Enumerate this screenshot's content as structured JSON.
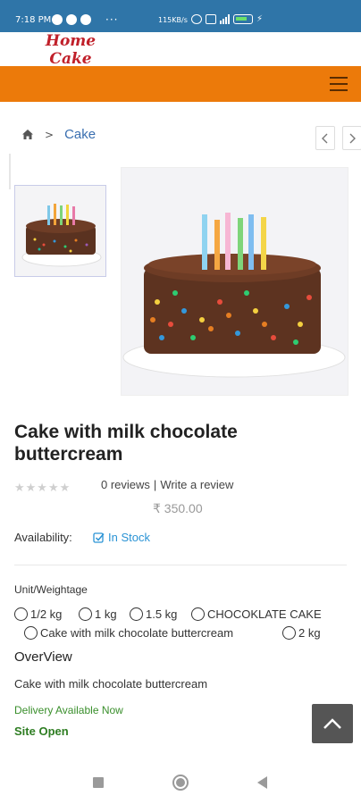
{
  "status_bar": {
    "time": "7:18 PM",
    "more": "···",
    "speed": "115KB/s"
  },
  "header": {
    "logo_text": "Home Cake"
  },
  "breadcrumb": {
    "home_icon": "home-icon",
    "separator": ">",
    "category": "Cake"
  },
  "product": {
    "title": "Cake with milk chocolate buttercream",
    "rating_stars": 0,
    "reviews_text": "0 reviews",
    "review_separator": "|",
    "write_review": "Write a review",
    "price": "₹ 350.00",
    "availability_label": "Availability:",
    "stock_status": "In Stock",
    "options_label": "Unit/Weightage",
    "options": [
      "1/2 kg",
      "1 kg",
      "1.5 kg",
      "CHOCOKLATE CAKE",
      "Cake with milk chocolate buttercream",
      "2 kg"
    ],
    "overview_heading": "OverView",
    "overview_text": "Cake with milk chocolate buttercream",
    "delivery_text": "Delivery Available Now",
    "site_status": "Site Open"
  },
  "colors": {
    "status_bar": "#2f75a8",
    "nav_orange": "#ec7a0a",
    "link_blue": "#3a6fb0",
    "stock_blue": "#2a93d5",
    "delivery_green": "#3a8f2c"
  }
}
